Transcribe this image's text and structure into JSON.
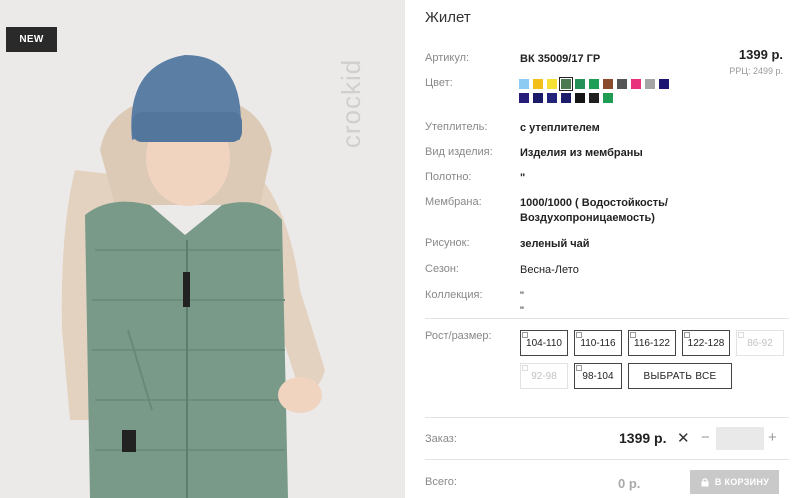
{
  "badge": "NEW",
  "brand": "crockid",
  "product": {
    "title": "Жилет",
    "article_label": "Артикул:",
    "article_value": "ВК 35009/17 ГР",
    "price": "1399 р.",
    "rrp": "РРЦ: 2499 р.",
    "color_label": "Цвет:",
    "colors": [
      "#8ecbf2",
      "#f3c01b",
      "#f7e034",
      "#4b7a52",
      "#25925a",
      "#1f9e56",
      "#8a4b2c",
      "#555555",
      "#e8327c",
      "#a5a5a5",
      "#1a1570",
      "#261d7a",
      "#1b1a68",
      "#23237b",
      "#1c1c6a",
      "#151515",
      "#1f1f1f",
      "#1f9b54"
    ],
    "selected_color_index": 3,
    "attributes": [
      {
        "label": "Утеплитель:",
        "value": "с утеплителем",
        "bold": true
      },
      {
        "label": "Вид изделия:",
        "value": "Изделия из мембраны",
        "bold": true
      },
      {
        "label": "Полотно:",
        "value": "\"",
        "bold": true
      },
      {
        "label": "Мембрана:",
        "value": "1000/1000 ( Водостойкость/",
        "value2": "Воздухопроницаемость)",
        "bold": true
      },
      {
        "label": "Рисунок:",
        "value": "зеленый чай",
        "bold": true
      },
      {
        "label": "Сезон:",
        "value": "Весна-Лето",
        "bold": false
      },
      {
        "label": "Коллекция:",
        "value": "\"",
        "value2": "\"",
        "bold": false
      }
    ],
    "size_label": "Рост/размер:",
    "sizes": [
      {
        "label": "104-110",
        "disabled": false
      },
      {
        "label": "110-116",
        "disabled": false
      },
      {
        "label": "116-122",
        "disabled": false
      },
      {
        "label": "122-128",
        "disabled": false
      },
      {
        "label": "86-92",
        "disabled": true
      },
      {
        "label": "92-98",
        "disabled": true
      },
      {
        "label": "98-104",
        "disabled": false
      }
    ],
    "select_all": "ВЫБРАТЬ ВСЕ"
  },
  "order": {
    "label": "Заказ:",
    "price": "1399 р.",
    "times": "✕",
    "minus": "−",
    "plus": "+",
    "quantity": ""
  },
  "total": {
    "label": "Всего:",
    "value": "0 р.",
    "cart_button": "В КОРЗИНУ"
  }
}
